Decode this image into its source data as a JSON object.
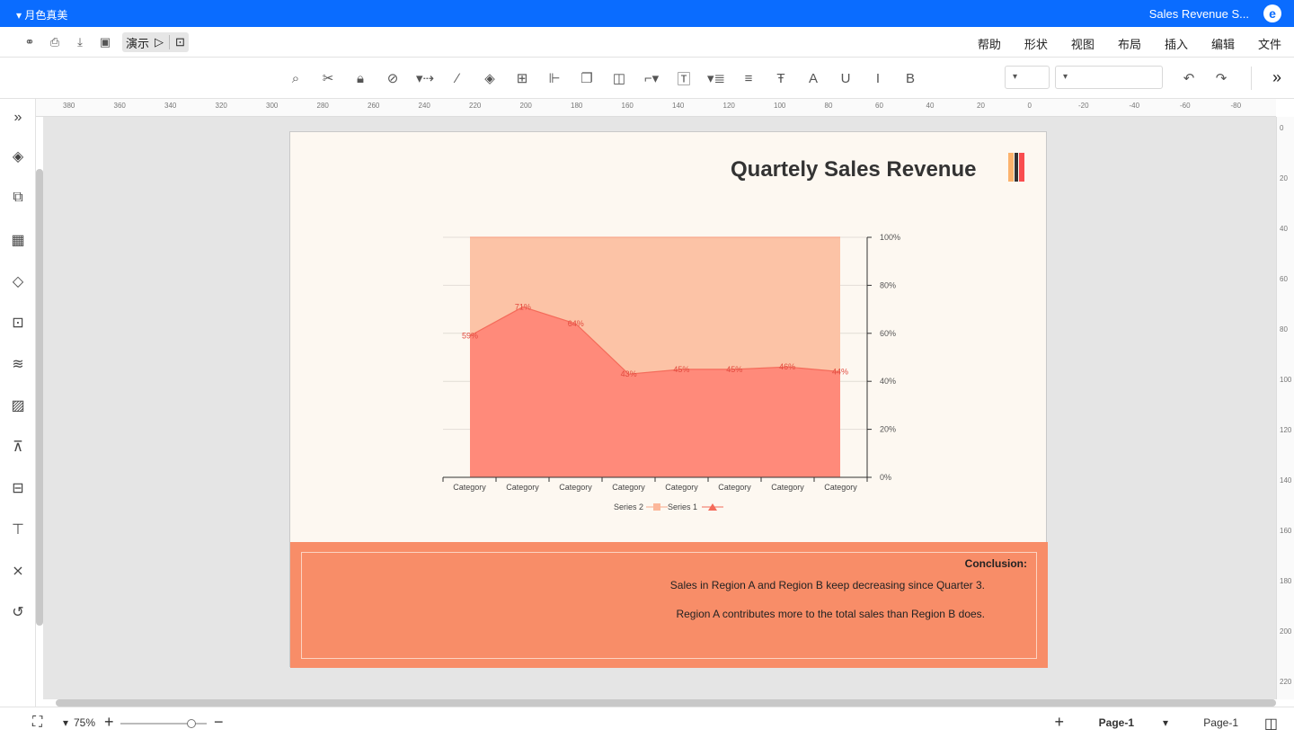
{
  "app": {
    "doc_title": "Sales Revenue S...",
    "theme_name": "月色真美"
  },
  "menu": [
    "文件",
    "编辑",
    "插入",
    "布局",
    "视图",
    "形状",
    "帮助"
  ],
  "quick": {
    "present_label": "演示"
  },
  "colors": {
    "accent": "#0a6cff",
    "panel": "#fdf8f1",
    "conclusion_bg": "#f88d68",
    "series1": "#ff8a7a",
    "series2": "#fcc3a6"
  },
  "ruler_h": [
    "380",
    "360",
    "340",
    "320",
    "300",
    "280",
    "260",
    "240",
    "220",
    "200",
    "180",
    "160",
    "140",
    "120",
    "100",
    "80",
    "60",
    "40",
    "20",
    "0",
    "-20",
    "-40",
    "-60",
    "-80"
  ],
  "ruler_v": [
    "0",
    "20",
    "40",
    "60",
    "80",
    "100",
    "120",
    "140",
    "160",
    "180",
    "200",
    "220"
  ],
  "page": {
    "title": "Quartely Sales Revenue",
    "conclusion_title": "Conclusion:",
    "conclusion_line1": "Sales in Region A and Region B keep decreasing since Quarter 3.",
    "conclusion_line2": "Region A contributes more to the total sales than Region B does."
  },
  "chart_data": {
    "type": "area",
    "stacked": true,
    "categories": [
      "Category",
      "Category",
      "Category",
      "Category",
      "Category",
      "Category",
      "Category",
      "Category"
    ],
    "series": [
      {
        "name": "Series 1",
        "values": [
          44,
          46,
          45,
          45,
          43,
          64,
          71,
          59
        ]
      },
      {
        "name": "Series 2",
        "values": [
          56,
          54,
          55,
          55,
          57,
          36,
          29,
          41
        ]
      }
    ],
    "data_labels": [
      "44%",
      "46%",
      "45%",
      "45%",
      "43%",
      "64%",
      "71%",
      "59%"
    ],
    "yticks": [
      "0%",
      "20%",
      "40%",
      "60%",
      "80%",
      "100%"
    ],
    "ylim": [
      0,
      100
    ],
    "legend": "bottom",
    "grid": true
  },
  "status": {
    "page_selector": "Page-1",
    "page_tab": "Page-1",
    "zoom": "75%"
  }
}
